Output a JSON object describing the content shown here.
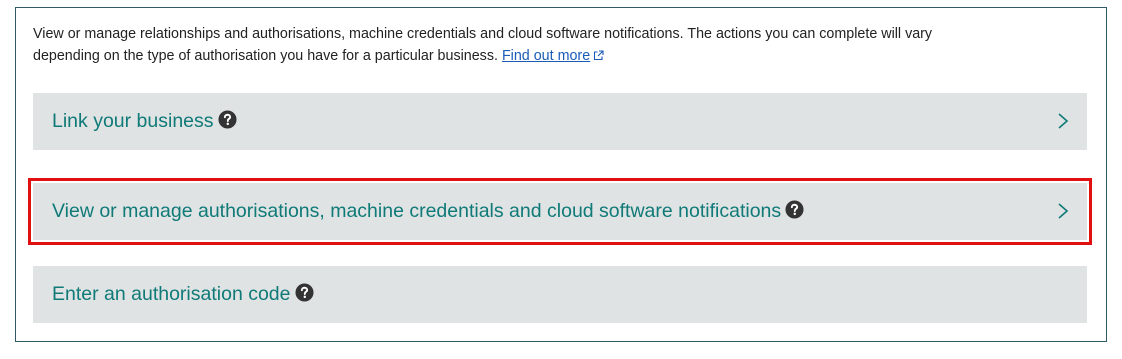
{
  "intro": {
    "text_line1": "View or manage relationships and authorisations, machine credentials and cloud software notifications. The actions you can complete will vary",
    "text_line2": "depending on the type of authorisation you have for a particular business. ",
    "link_label": "Find out more"
  },
  "options": [
    {
      "label": "Link your business"
    },
    {
      "label": "View or manage authorisations, machine credentials and cloud software notifications"
    },
    {
      "label": "Enter an authorisation code"
    }
  ],
  "icons": {
    "help": "question-circle-icon",
    "external": "external-link-icon",
    "chevron": "chevron-right-icon"
  },
  "colors": {
    "accent_text": "#0f7a78",
    "option_background": "#dfe3e3",
    "link": "#1a5bb8",
    "highlight_outline": "#e01010",
    "panel_border": "#2f5a66"
  }
}
